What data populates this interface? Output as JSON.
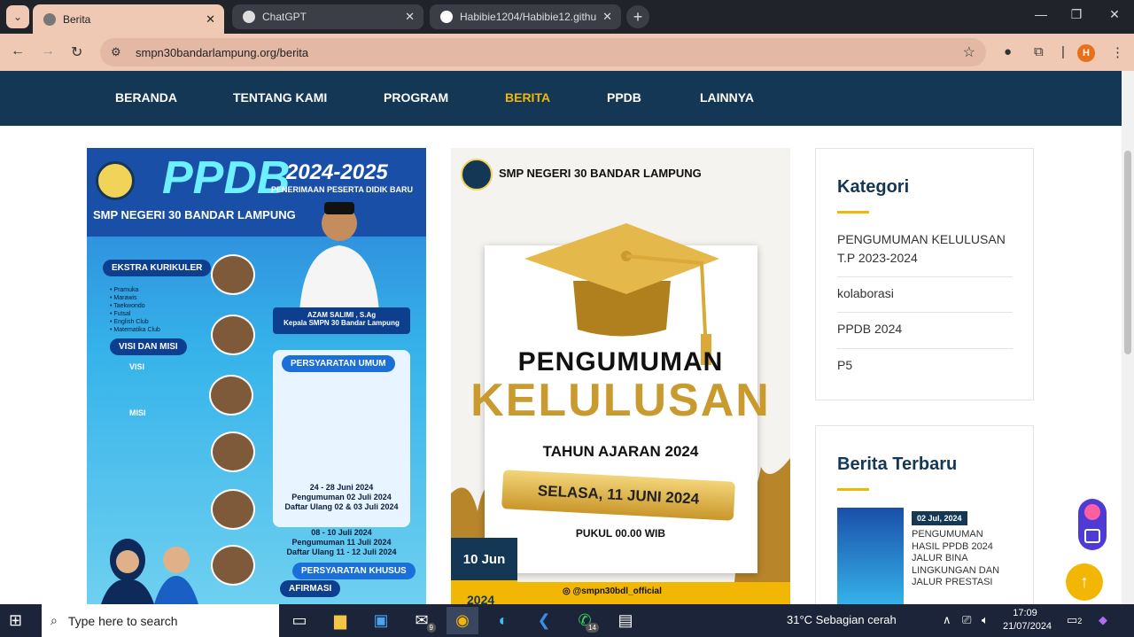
{
  "browser": {
    "tabs": [
      {
        "title": "Berita",
        "active": true
      },
      {
        "title": "ChatGPT",
        "active": false
      },
      {
        "title": "Habibie1204/Habibie12.githu",
        "active": false
      }
    ],
    "url": "smpn30bandarlampung.org/berita",
    "profile_initial": "H"
  },
  "site_nav": {
    "items": [
      "BERANDA",
      "TENTANG KAMI",
      "PROGRAM",
      "BERITA",
      "PPDB",
      "LAINNYA"
    ],
    "active": "BERITA",
    "accent": "#f2b705"
  },
  "card_ppdb": {
    "title": "PPDB",
    "year": "2024-2025",
    "subtitle": "PENERIMAAN PESERTA DIDIK BARU",
    "school": "SMP NEGERI 30 BANDAR LAMPUNG",
    "ekstra_label": "EKSTRA KURIKULER",
    "ekstra_items": "• Pramuka\n• Marawis\n• Taekwondo\n• Futsal\n• English Club\n• Matematika Club",
    "visi_misi_label": "VISI DAN MISI",
    "visi_label": "VISI",
    "misi_label": "MISI",
    "principal_name": "AZAM SALIMI , S.Ag",
    "principal_title": "Kepala SMPN 30 Bandar Lampung",
    "persyaratan_label": "PERSYARATAN UMUM",
    "date1": "24 - 28 Juni 2024",
    "date2": "Pengumuman 02 Juli 2024",
    "date3": "Daftar Ulang 02 & 03 Juli 2024",
    "date4": "08 - 10 Juli 2024",
    "date5": "Pengumuman  11 Juli 2024",
    "date6": "Daftar Ulang 11 - 12 Juli 2024",
    "khusus_label": "PERSYARATAN KHUSUS",
    "afirmasi_label": "AFIRMASI"
  },
  "card_kelulusan": {
    "school": "SMP NEGERI 30 BANDAR LAMPUNG",
    "heading1": "PENGUMUMAN",
    "heading2": "KELULUSAN",
    "academic_year": "TAHUN AJARAN 2024",
    "ribbon": "SELASA, 11 JUNI 2024",
    "time": "PUKUL 00.00 WIB",
    "instagram": "@smpn30bdl_official",
    "date_badge": "10 Jun",
    "year_badge": "2024"
  },
  "sidebar": {
    "kategori_title": "Kategori",
    "categories": [
      "PENGUMUMAN KELULUSAN T.P 2023-2024",
      "kolaborasi",
      "PPDB 2024",
      "P5"
    ],
    "recent_title": "Berita Terbaru",
    "recent": {
      "date": "02 Jul, 2024",
      "title": "PENGUMUMAN HASIL PPDB 2024 JALUR BINA LINGKUNGAN DAN JALUR PRESTASI"
    }
  },
  "taskbar": {
    "search_placeholder": "Type here to search",
    "mail_badge": "9",
    "whatsapp_badge": "14",
    "weather": "31°C  Sebagian cerah",
    "time": "17:09",
    "date": "21/07/2024",
    "notif_count": "2"
  }
}
